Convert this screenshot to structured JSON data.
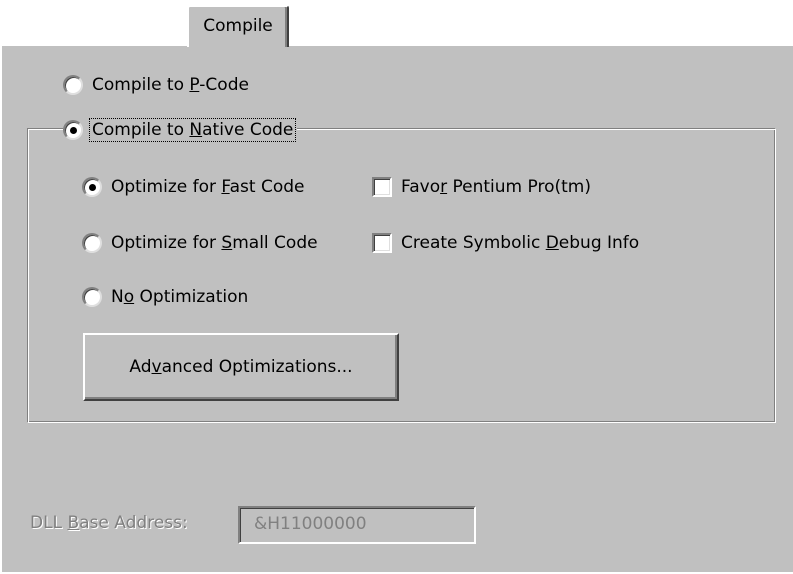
{
  "tabs": [
    {
      "label": "Compile",
      "selected": true
    }
  ],
  "compile_pcode": {
    "pre": "Compile to ",
    "key": "P",
    "post": "-Code",
    "checked": false
  },
  "compile_native": {
    "pre": "Compile to ",
    "key": "N",
    "post": "ative Code",
    "checked": true
  },
  "optimize_fast": {
    "pre": "Optimize for ",
    "key": "F",
    "post": "ast Code",
    "checked": true
  },
  "optimize_small": {
    "pre": "Optimize for ",
    "key": "S",
    "post": "mall Code",
    "checked": false
  },
  "no_optimization": {
    "pre": "N",
    "key": "o",
    "post": " Optimization",
    "checked": false
  },
  "favor_pentium": {
    "pre": "Favo",
    "key": "r",
    "post": " Pentium Pro(tm)",
    "checked": false
  },
  "symbolic_debug": {
    "pre": "Create Symbolic ",
    "key": "D",
    "post": "ebug Info",
    "checked": false
  },
  "advanced_button": {
    "pre": "Ad",
    "key": "v",
    "post": "anced Optimizations..."
  },
  "dll_base": {
    "pre": "DLL ",
    "key": "B",
    "post": "ase Address:",
    "value": "&H11000000",
    "disabled": true
  }
}
